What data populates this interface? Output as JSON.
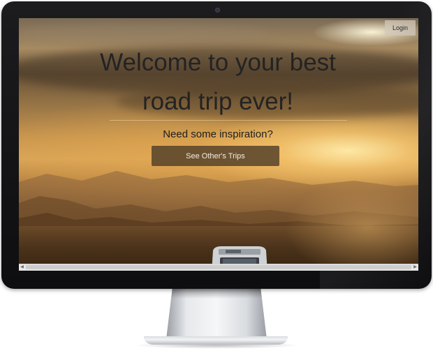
{
  "device": {
    "icons": {
      "camera": "camera-icon"
    }
  },
  "page": {
    "header": {
      "login_label": "Login"
    },
    "hero": {
      "title_line1": "Welcome to your best",
      "title_line2": "road trip ever!",
      "subtitle": "Need some inspiration?",
      "cta_label": "See Other's Trips"
    },
    "scrollbar": {
      "left_arrow_icon": "scroll-left-arrow-icon",
      "right_arrow_icon": "scroll-right-arrow-icon"
    }
  },
  "colors": {
    "title_text": "#232323",
    "cta_background": "#503e28",
    "cta_text": "#f4ede2",
    "login_background": "#d2c8b9"
  }
}
